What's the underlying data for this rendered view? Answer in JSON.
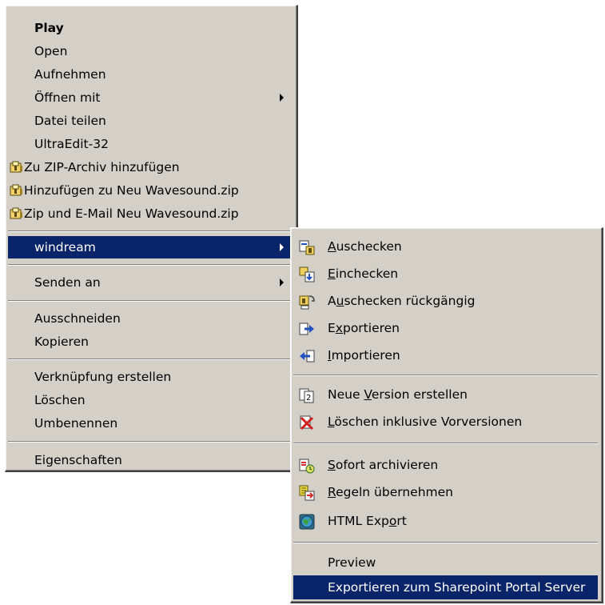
{
  "main_menu": {
    "items": [
      {
        "label": "Play"
      },
      {
        "label": "Open"
      },
      {
        "label": "Aufnehmen"
      },
      {
        "label": "Öffnen mit"
      },
      {
        "label": "Datei teilen"
      },
      {
        "label": "UltraEdit-32"
      },
      {
        "label": "Zu ZIP-Archiv hinzufügen",
        "icon": "winzip-icon"
      },
      {
        "label": "Hinzufügen zu Neu Wavesound.zip",
        "icon": "winzip-icon"
      },
      {
        "label": "Zip und E-Mail Neu Wavesound.zip",
        "icon": "winzip-icon"
      },
      {
        "label": "windream",
        "selected": true
      },
      {
        "label": "Senden an"
      },
      {
        "label": "Ausschneiden"
      },
      {
        "label": "Kopieren"
      },
      {
        "label": "Verknüpfung erstellen"
      },
      {
        "label": "Löschen"
      },
      {
        "label": "Umbenennen"
      },
      {
        "label": "Eigenschaften"
      }
    ]
  },
  "sub_menu": {
    "items": [
      {
        "label_pre": "",
        "label_u": "A",
        "label_post": "uschecken",
        "icon": "checkout-icon"
      },
      {
        "label_pre": "",
        "label_u": "E",
        "label_post": "inchecken",
        "icon": "checkin-icon"
      },
      {
        "label_pre": "A",
        "label_u": "u",
        "label_post": "schecken rückgängig",
        "icon": "undo-checkout-icon"
      },
      {
        "label_pre": "E",
        "label_u": "x",
        "label_post": "portieren",
        "icon": "export-icon"
      },
      {
        "label_pre": "",
        "label_u": "I",
        "label_post": "mportieren",
        "icon": "import-icon"
      },
      {
        "label_pre": "Neue ",
        "label_u": "V",
        "label_post": "ersion erstellen",
        "icon": "new-version-icon"
      },
      {
        "label_pre": "",
        "label_u": "L",
        "label_post": "öschen inklusive Vorversionen",
        "icon": "delete-versions-icon"
      },
      {
        "label_pre": "",
        "label_u": "S",
        "label_post": "ofort archivieren",
        "icon": "archive-icon"
      },
      {
        "label_pre": "",
        "label_u": "R",
        "label_post": "egeln übernehmen",
        "icon": "rules-icon"
      },
      {
        "label_pre": "HTML Exp",
        "label_u": "o",
        "label_post": "rt",
        "icon": "globe-icon"
      },
      {
        "label_pre": "Preview",
        "label_u": "",
        "label_post": ""
      },
      {
        "label_pre": "Exportieren zum Sharepoint Portal Server",
        "label_u": "",
        "label_post": "",
        "selected": true
      }
    ]
  },
  "colors": {
    "menu_bg": "#d4d0c8",
    "highlight": "#0a246a",
    "highlight_text": "#ffffff"
  }
}
